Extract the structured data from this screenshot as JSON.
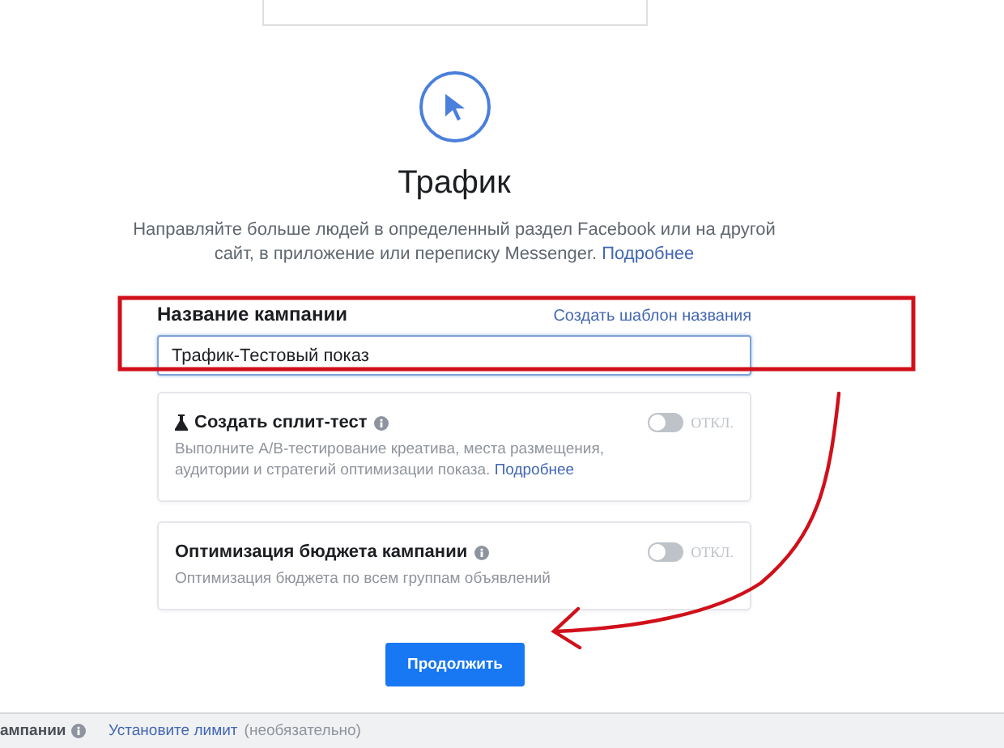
{
  "objective": {
    "title": "Трафик",
    "description": "Направляйте больше людей в определенный раздел Facebook или на другой сайт, в приложение или переписку Messenger.",
    "more_link": "Подробнее"
  },
  "campaign_name": {
    "label": "Название кампании",
    "template_link": "Создать шаблон названия",
    "value": "Трафик-Тестовый показ"
  },
  "options": [
    {
      "kind": "split_test",
      "title": "Создать сплит-тест",
      "description": "Выполните A/B-тестирование креатива, места размещения, аудитории и стратегий оптимизации показа.",
      "more_link": "Подробнее",
      "on": false,
      "state_label": "ОТКЛ."
    },
    {
      "kind": "budget",
      "title": "Оптимизация бюджета кампании",
      "description": "Оптимизация бюджета по всем группам объявлений",
      "on": false,
      "state_label": "ОТКЛ."
    }
  ],
  "continue_button": "Продолжить",
  "footer": {
    "label": "ампании",
    "link": "Установите лимит",
    "hint": "(необязательно)"
  }
}
